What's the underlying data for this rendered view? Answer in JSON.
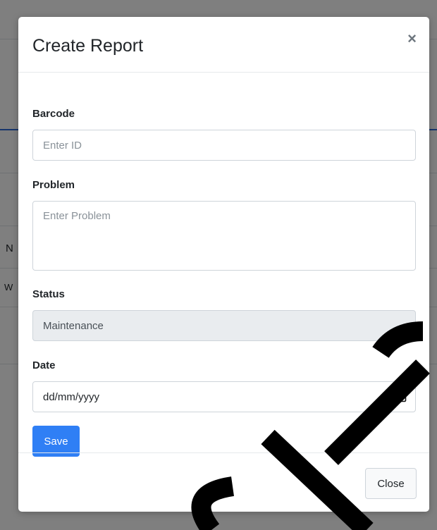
{
  "background": {
    "row_texts": [
      "N",
      "W"
    ]
  },
  "modal": {
    "title": "Create Report",
    "close_symbol": "×",
    "fields": {
      "barcode": {
        "label": "Barcode",
        "placeholder": "Enter ID",
        "value": ""
      },
      "problem": {
        "label": "Problem",
        "placeholder": "Enter Problem",
        "value": ""
      },
      "status": {
        "label": "Status",
        "value": "Maintenance"
      },
      "date": {
        "label": "Date",
        "value": "dd/mm/yyyy",
        "icon": "calendar-icon"
      }
    },
    "save_label": "Save",
    "close_label": "Close"
  },
  "colors": {
    "primary": "#2f7ff5",
    "readonly_bg": "#e9ecef",
    "backdrop": "rgba(0,0,0,0.5)"
  }
}
